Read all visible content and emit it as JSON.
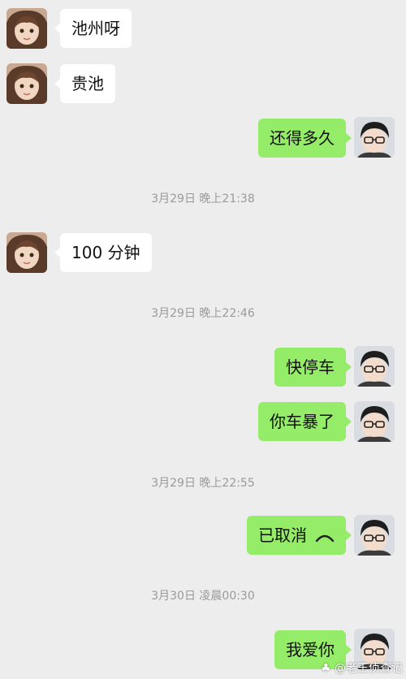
{
  "messages": [
    {
      "side": "in",
      "text": "池州呀"
    },
    {
      "side": "in",
      "text": "贵池"
    },
    {
      "side": "out",
      "text": "还得多久"
    },
    {
      "side": "in",
      "text": "100 分钟"
    },
    {
      "side": "out",
      "text": "快停车"
    },
    {
      "side": "out",
      "text": "你车暴了"
    },
    {
      "side": "out",
      "text": "已取消"
    },
    {
      "side": "out",
      "text": "我爱你"
    }
  ],
  "timestamps": [
    "3月29日 晚上21:38",
    "3月29日 晚上22:46",
    "3月29日 晚上22:55",
    "3月30日 凌晨00:30"
  ],
  "watermark": "@老王侦查记",
  "colors": {
    "background": "#ededed",
    "outgoing_bubble": "#95ec69",
    "incoming_bubble": "#ffffff",
    "timestamp": "#9a9a9a"
  }
}
